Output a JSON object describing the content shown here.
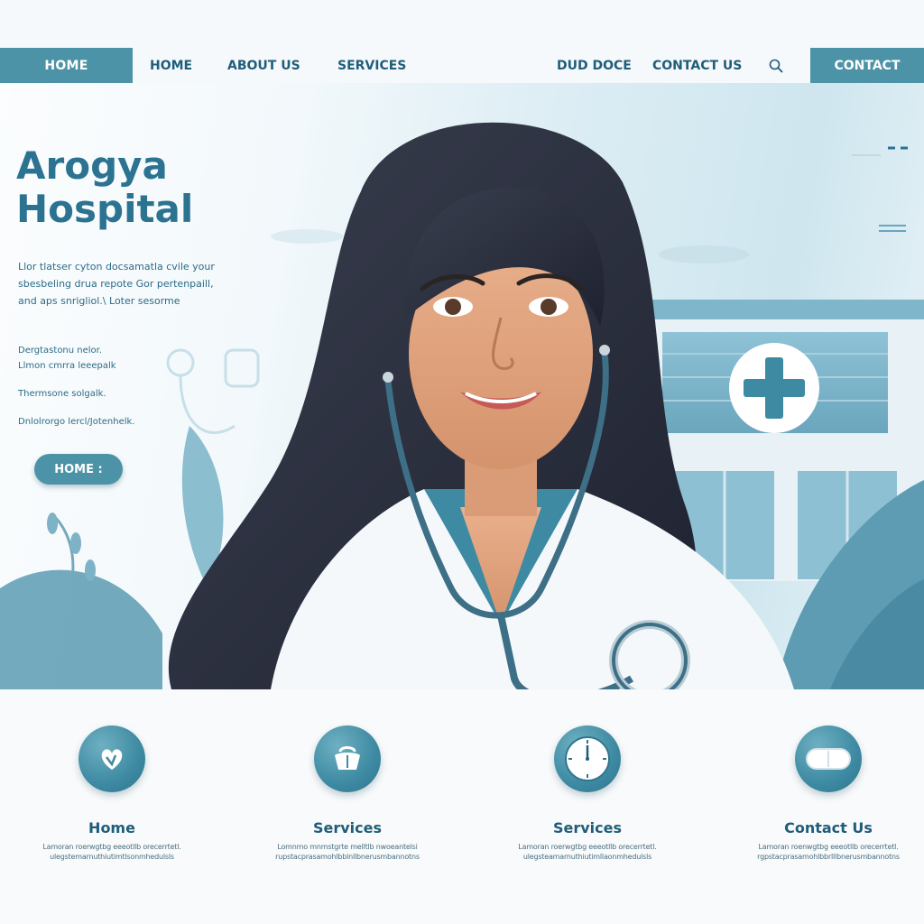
{
  "nav": {
    "home_tab": "HOME",
    "links": [
      "HOME",
      "ABOUT US",
      "SERVICES",
      "DUD DOCE",
      "CONTACT US"
    ],
    "contact_button": "CONTACT",
    "search_icon": "search-icon"
  },
  "hero": {
    "title_line1": "Arogya",
    "title_line2": "Hospital",
    "description_lines": [
      "Llor tlatser cyton docsamatla cvile your",
      "sbesbeling drua repote Gor pertenpaill,",
      "and aps snrigliol.\\       Loter sesorme"
    ],
    "bullets": [
      "Dergtastonu nelor.",
      "Llmon cmrra leeepalk",
      "Thermsone solgalk.",
      "Dnlolrorgo lercl/Jotenhelk."
    ],
    "button_label": "HOME :"
  },
  "features": [
    {
      "icon": "heart-hands-icon",
      "title": "Home",
      "text_lines": [
        "Lamoran roerwgtbg eeeotllb orecerrtetl.",
        "ulegstemarnuthiutimtlsonmhedulsls"
      ]
    },
    {
      "icon": "doctor-bag-icon",
      "title": "Services",
      "text_lines": [
        "Lomnmo mnmstgrte melltlb nwoeantelsi",
        "rupstacprasamohlbblnllbnerusmbannotns"
      ]
    },
    {
      "icon": "clock-icon",
      "title": "Services",
      "text_lines": [
        "Lamoran roerwgtbg eeeotllb orecerrtetl.",
        "ulegsteamarnuthiutimllaonmhedulsls"
      ]
    },
    {
      "icon": "pill-icon",
      "title": "Contact Us",
      "text_lines": [
        "Lamoran roenwgtbg eeeotllb orecerrtetl.",
        "rgpstacprasamohlbbrlllbnerusmbannotns"
      ]
    }
  ],
  "colors": {
    "accent": "#4d93a8",
    "heading": "#2b7391",
    "text": "#1f5d7a"
  }
}
